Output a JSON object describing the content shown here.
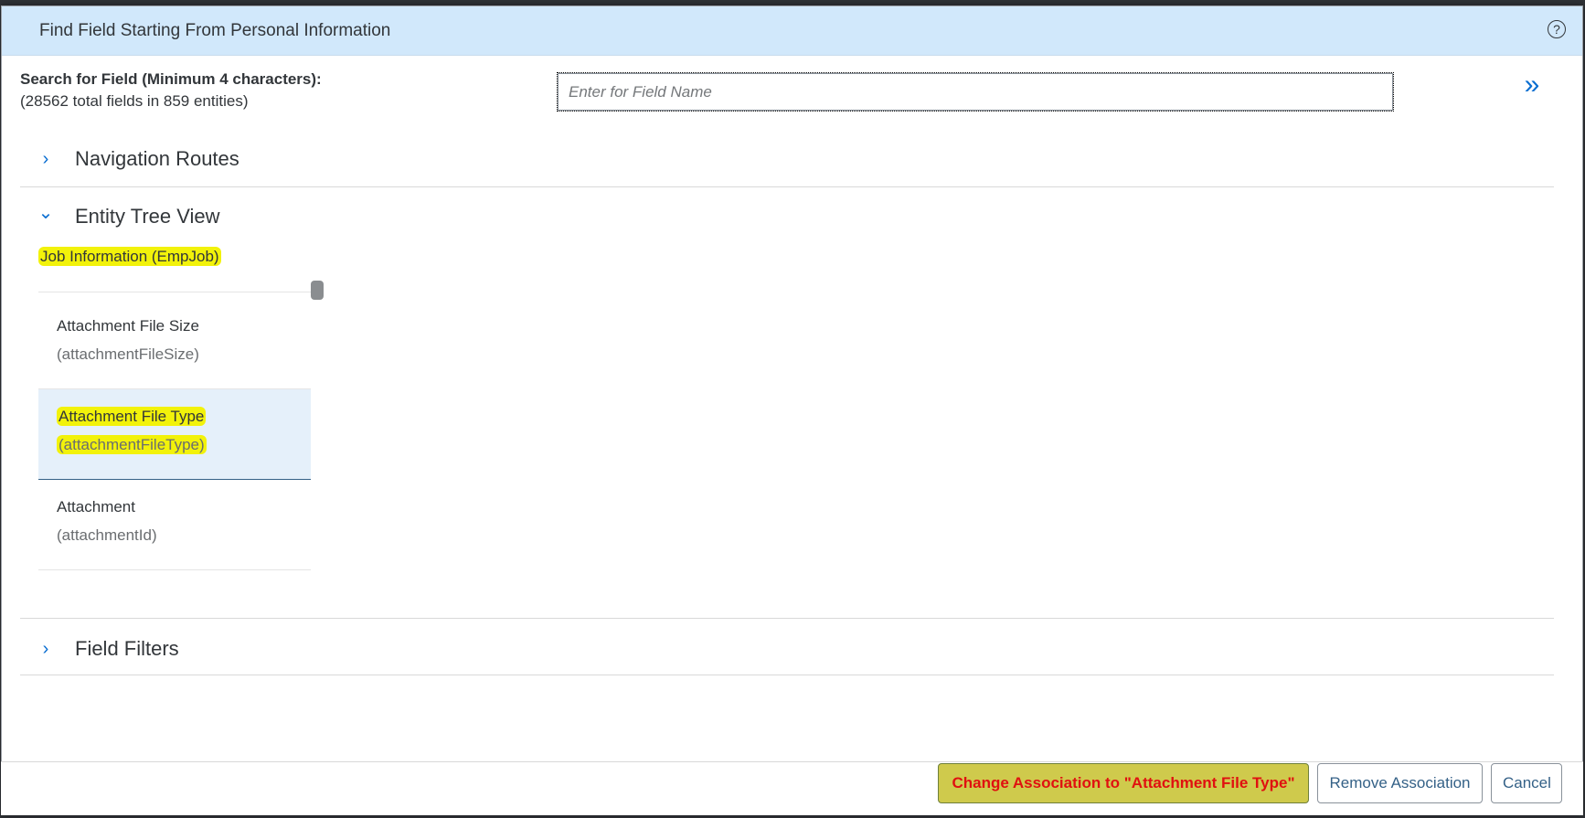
{
  "dialog": {
    "title": "Find Field Starting From Personal Information",
    "help_icon": "?"
  },
  "search": {
    "label": "Search for Field (Minimum 4 characters):",
    "sublabel": "(28562 total fields in 859 entities)",
    "placeholder": "Enter for Field Name",
    "value": "",
    "expand_icon": "»"
  },
  "panels": {
    "navigation_routes": {
      "title": "Navigation Routes",
      "chevron": "›",
      "expanded": false
    },
    "entity_tree_view": {
      "title": "Entity Tree View",
      "chevron": "⌄",
      "expanded": true
    },
    "field_filters": {
      "title": "Field Filters",
      "chevron": "›",
      "expanded": false
    }
  },
  "entity_tree": {
    "entity_title": "Job Information (EmpJob)",
    "fields": [
      {
        "name": "Attachment File Size",
        "id": "(attachmentFileSize)",
        "selected": false
      },
      {
        "name": "Attachment File Type",
        "id": "(attachmentFileType)",
        "selected": true
      },
      {
        "name": "Attachment",
        "id": "(attachmentId)",
        "selected": false
      }
    ]
  },
  "footer": {
    "change_association": "Change Association to \"Attachment File Type\"",
    "remove_association": "Remove Association",
    "cancel": "Cancel"
  },
  "colors": {
    "header_bg": "#d1e8fb",
    "highlight": "#f2f20a",
    "primary_btn_bg": "#cfca4c",
    "primary_btn_text": "#e01010",
    "accent": "#0a6ed1"
  }
}
